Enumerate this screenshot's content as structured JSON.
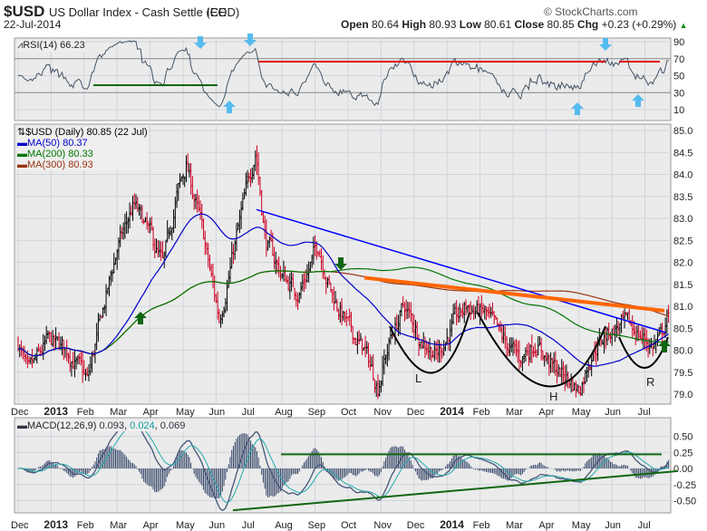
{
  "header": {
    "symbol": "$USD",
    "name": "US Dollar Index - Cash Settle (EOD)",
    "exchange": "ICE",
    "date": "22-Jul-2014",
    "copyright": "© StockCharts.com",
    "open_label": "Open",
    "open": "80.64",
    "high_label": "High",
    "high": "80.93",
    "low_label": "Low",
    "low": "80.61",
    "close_label": "Close",
    "close": "80.85",
    "chg_label": "Chg",
    "chg": "+0.23 (+0.29%)"
  },
  "colors": {
    "ma50": "#0000cc",
    "ma200": "#007700",
    "ma300": "#993311",
    "up": "#000000",
    "down": "#cc0022",
    "orange": "#ff6600",
    "arrow_blue": "#55bbee",
    "arrow_green": "#116611"
  },
  "chart_data": [
    {
      "type": "line",
      "title": "RSI(14) 66.23",
      "ylim": [
        0,
        100
      ],
      "yticks": [
        "90",
        "70",
        "50",
        "30",
        "10"
      ],
      "ytick_values": [
        90,
        70,
        50,
        30,
        10
      ]
    },
    {
      "type": "candlestick",
      "title": "$USD (Daily) 80.85 (22 Jul)",
      "legend": [
        "MA(50) 80.37",
        "MA(200) 80.33",
        "MA(300) 80.93"
      ],
      "ylim": [
        78.8,
        85.2
      ],
      "yticks": [
        "85.0",
        "84.5",
        "84.0",
        "83.5",
        "83.0",
        "82.5",
        "82.0",
        "81.5",
        "81.0",
        "80.5",
        "80.0",
        "79.5",
        "79.0"
      ],
      "ytick_values": [
        85,
        84.5,
        84,
        83.5,
        83,
        82.5,
        82,
        81.5,
        81,
        80.5,
        80,
        79.5,
        79
      ],
      "x_unit": "months since 1-Dec-2012",
      "price_anchors": [
        [
          0,
          80.2
        ],
        [
          0.3,
          79.4
        ],
        [
          0.9,
          80.2
        ],
        [
          1.5,
          80.0
        ],
        [
          2.1,
          79.3
        ],
        [
          2.6,
          81.0
        ],
        [
          3.0,
          82.3
        ],
        [
          3.5,
          83.3
        ],
        [
          4.0,
          82.6
        ],
        [
          4.4,
          81.9
        ],
        [
          4.8,
          83.5
        ],
        [
          5.1,
          84.2
        ],
        [
          5.5,
          83.0
        ],
        [
          6.1,
          80.7
        ],
        [
          6.4,
          81.8
        ],
        [
          7.2,
          84.6
        ],
        [
          7.5,
          82.5
        ],
        [
          8.0,
          81.7
        ],
        [
          8.5,
          81.3
        ],
        [
          9.1,
          82.4
        ],
        [
          9.5,
          81.3
        ],
        [
          10.1,
          80.4
        ],
        [
          10.5,
          80.0
        ],
        [
          10.9,
          79.2
        ],
        [
          11.3,
          80.3
        ],
        [
          11.7,
          81.0
        ],
        [
          12.2,
          80.3
        ],
        [
          12.7,
          79.9
        ],
        [
          13.2,
          80.6
        ],
        [
          13.6,
          81.0
        ],
        [
          14.2,
          80.8
        ],
        [
          14.6,
          80.3
        ],
        [
          15.2,
          79.8
        ],
        [
          15.7,
          80.2
        ],
        [
          16.2,
          79.6
        ],
        [
          16.6,
          79.4
        ],
        [
          17.0,
          79.1
        ],
        [
          17.4,
          80.0
        ],
        [
          17.9,
          80.4
        ],
        [
          18.3,
          80.6
        ],
        [
          18.8,
          80.4
        ],
        [
          19.2,
          80.1
        ],
        [
          19.5,
          80.3
        ],
        [
          19.7,
          80.85
        ]
      ],
      "annotations": {
        "labels": [
          "L",
          "H",
          "R"
        ]
      }
    },
    {
      "type": "line",
      "title": "MACD(12,26,9)",
      "values": [
        "0.093",
        "0.024",
        "0.069"
      ],
      "ylim": [
        -0.75,
        0.75
      ],
      "yticks": [
        "0.50",
        "0.25",
        "0.00",
        "-0.25",
        "-0.50"
      ],
      "ytick_values": [
        0.5,
        0.25,
        0,
        -0.25,
        -0.5
      ]
    }
  ],
  "x_axis": {
    "months": [
      "Dec",
      "2013",
      "Feb",
      "Mar",
      "Apr",
      "May",
      "Jun",
      "Jul",
      "Aug",
      "Sep",
      "Oct",
      "Nov",
      "Dec",
      "2014",
      "Feb",
      "Mar",
      "Apr",
      "May",
      "Jun",
      "Jul"
    ],
    "year_indices": [
      1,
      13
    ]
  }
}
